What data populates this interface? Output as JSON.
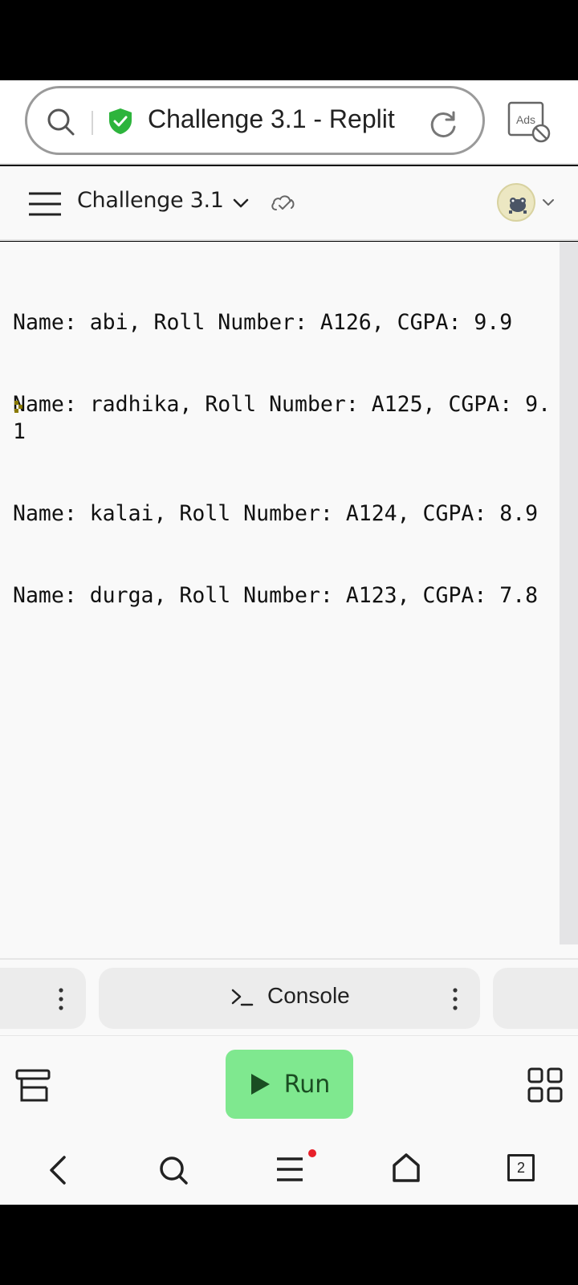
{
  "browser": {
    "tab_title": "Challenge 3.1 - Replit",
    "ads_label": "Ads"
  },
  "app": {
    "project_name": "Challenge 3.1"
  },
  "console": {
    "output_lines": [
      "Name: abi, Roll Number: A126, CGPA: 9.9",
      "Name: radhika, Roll Number: A125, CGPA: 9.1",
      "Name: kalai, Roll Number: A124, CGPA: 8.9",
      "Name: durga, Roll Number: A123, CGPA: 7.8"
    ]
  },
  "tabs": {
    "console_label": "Console"
  },
  "toolbar": {
    "run_label": "Run"
  },
  "nav": {
    "tab_count": "2"
  },
  "colors": {
    "run_button": "#7fe88f",
    "shield": "#2db43c",
    "notification_dot": "#e8202a",
    "prompt_caret": "#8a7a00"
  }
}
